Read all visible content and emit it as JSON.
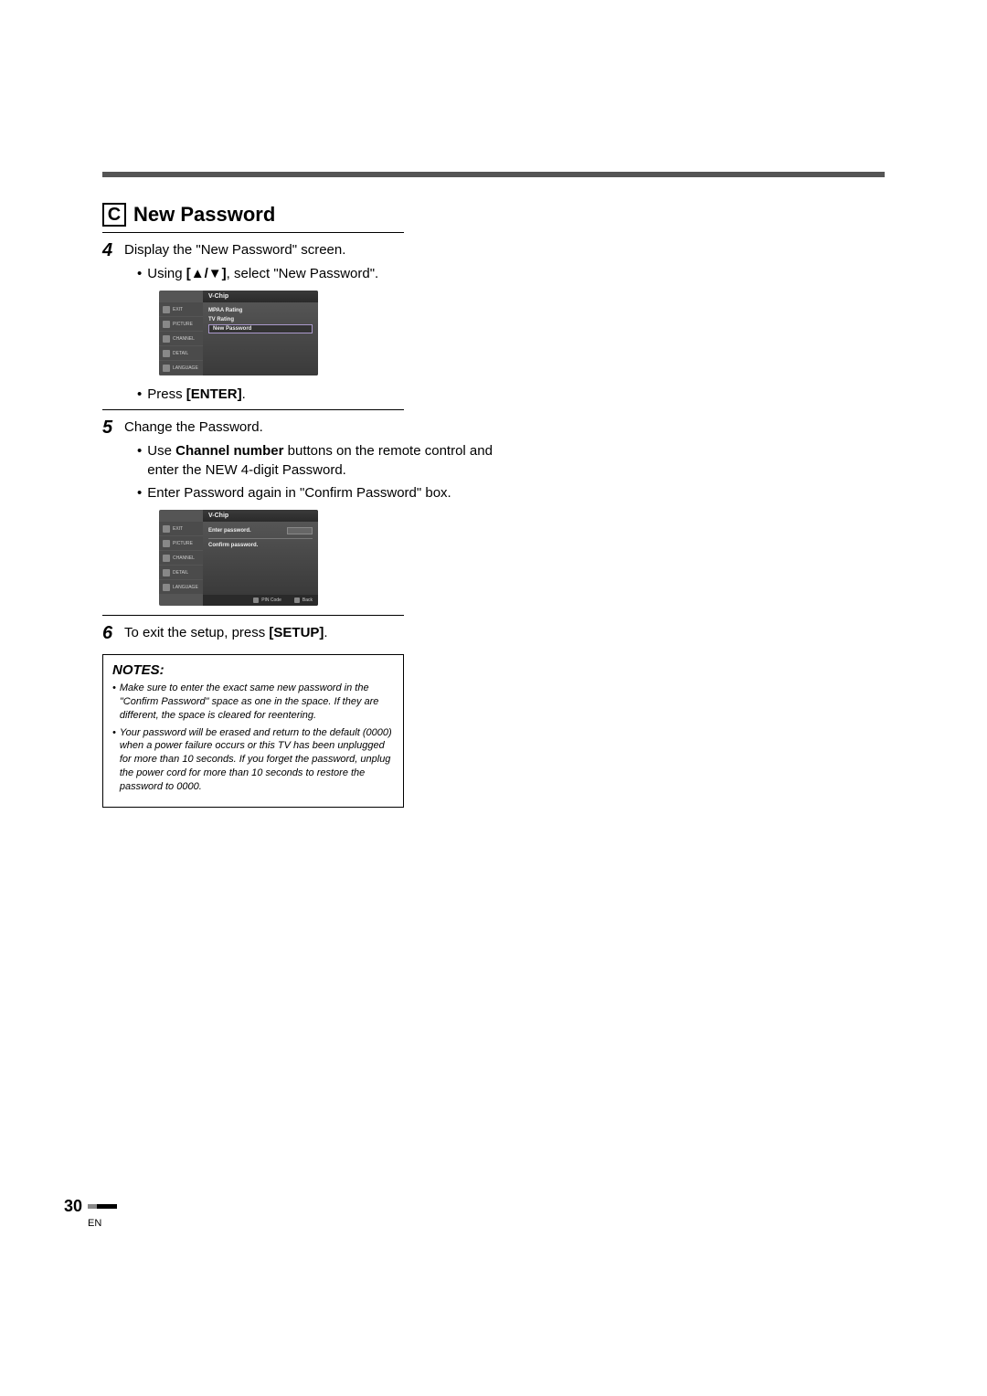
{
  "section": {
    "letter": "C",
    "title": "New Password"
  },
  "step4": {
    "num": "4",
    "text": "Display the \"New Password\" screen.",
    "sub1_pre": "Using ",
    "sub1_key": "[▲/▼]",
    "sub1_post": ", select \"New Password\".",
    "sub2_pre": "Press ",
    "sub2_key": "[ENTER]",
    "sub2_post": "."
  },
  "step5": {
    "num": "5",
    "text": "Change the Password.",
    "sub1_pre": "Use ",
    "sub1_bold": "Channel number",
    "sub1_post": " buttons on the remote control and enter the NEW 4-digit Password.",
    "sub2": "Enter Password again in \"Confirm Password\" box."
  },
  "step6": {
    "num": "6",
    "text_pre": "To exit the setup, press ",
    "text_bold": "[SETUP]",
    "text_post": "."
  },
  "osd1": {
    "header": "V-Chip",
    "side": [
      "EXIT",
      "PICTURE",
      "CHANNEL",
      "DETAIL",
      "LANGUAGE"
    ],
    "items": [
      "MPAA Rating",
      "TV Rating",
      "New Password"
    ]
  },
  "osd2": {
    "header": "V-Chip",
    "side": [
      "EXIT",
      "PICTURE",
      "CHANNEL",
      "DETAIL",
      "LANGUAGE"
    ],
    "row1": "Enter password.",
    "row2": "Confirm password.",
    "foot1": "PIN Code",
    "foot2": "Back"
  },
  "notes": {
    "title": "NOTES:",
    "n1": "Make sure to enter the exact same new password in the \"Confirm Password\" space as one in the space. If they are different, the space is cleared for reentering.",
    "n2": "Your password will be erased and return to the default (0000) when a power failure occurs or this TV has been unplugged for more than 10 seconds. If you forget the password, unplug the power cord for more than 10 seconds to restore the password to 0000."
  },
  "footer": {
    "page": "30",
    "lang": "EN"
  }
}
